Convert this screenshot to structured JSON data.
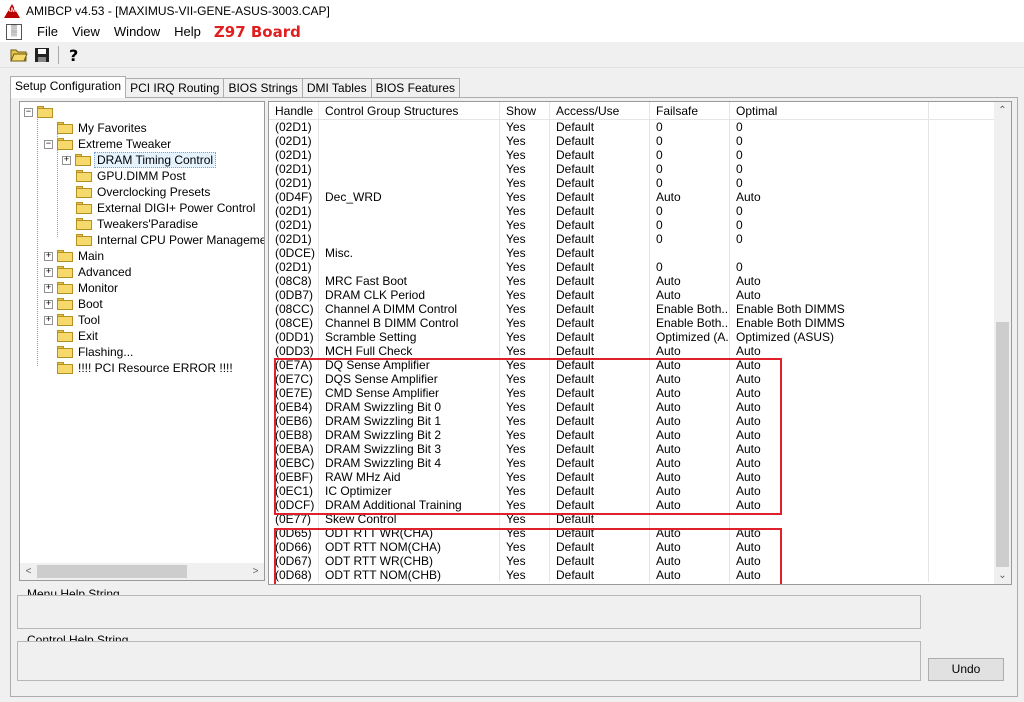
{
  "window": {
    "title": "AMIBCP v4.53 - [MAXIMUS-VII-GENE-ASUS-3003.CAP]",
    "app_icon_text": "AMI"
  },
  "menu": {
    "items": [
      "File",
      "View",
      "Window",
      "Help"
    ],
    "annotation": "Z97 Board",
    "annotation_color": "#e02020"
  },
  "toolbar": {
    "icons": [
      "open-folder-icon",
      "save-icon",
      "help-icon"
    ]
  },
  "tabs": [
    "Setup Configuration",
    "PCI IRQ Routing",
    "BIOS Strings",
    "DMI Tables",
    "BIOS Features"
  ],
  "active_tab": "Setup Configuration",
  "tree": {
    "root": "",
    "nodes": [
      "My Favorites",
      "Extreme Tweaker",
      "DRAM Timing Control",
      "GPU.DIMM Post",
      "Overclocking Presets",
      "External DIGI+ Power Control",
      "Tweakers'Paradise",
      "Internal CPU Power Management",
      "Main",
      "Advanced",
      "Monitor",
      "Boot",
      "Tool",
      "Exit",
      "Flashing...",
      "!!!! PCI Resource ERROR !!!!"
    ],
    "selected": "DRAM Timing Control"
  },
  "grid": {
    "columns": [
      "Handle",
      "Control Group Structures",
      "Show",
      "Access/Use",
      "Failsafe",
      "Optimal"
    ],
    "rows": [
      [
        "(02D1)",
        "",
        "Yes",
        "Default",
        "0",
        "0"
      ],
      [
        "(02D1)",
        "",
        "Yes",
        "Default",
        "0",
        "0"
      ],
      [
        "(02D1)",
        "",
        "Yes",
        "Default",
        "0",
        "0"
      ],
      [
        "(02D1)",
        "",
        "Yes",
        "Default",
        "0",
        "0"
      ],
      [
        "(02D1)",
        "",
        "Yes",
        "Default",
        "0",
        "0"
      ],
      [
        "(0D4F)",
        "Dec_WRD",
        "Yes",
        "Default",
        "Auto",
        "Auto"
      ],
      [
        "(02D1)",
        "",
        "Yes",
        "Default",
        "0",
        "0"
      ],
      [
        "(02D1)",
        "",
        "Yes",
        "Default",
        "0",
        "0"
      ],
      [
        "(02D1)",
        "",
        "Yes",
        "Default",
        "0",
        "0"
      ],
      [
        "(0DCE)",
        "Misc.",
        "Yes",
        "Default",
        "",
        ""
      ],
      [
        "(02D1)",
        "",
        "Yes",
        "Default",
        "0",
        "0"
      ],
      [
        "(08C8)",
        "MRC Fast Boot",
        "Yes",
        "Default",
        "Auto",
        "Auto"
      ],
      [
        "(0DB7)",
        "DRAM CLK Period",
        "Yes",
        "Default",
        "Auto",
        "Auto"
      ],
      [
        "(08CC)",
        "Channel A DIMM Control",
        "Yes",
        "Default",
        "Enable Both...",
        "Enable Both DIMMS"
      ],
      [
        "(08CE)",
        "Channel B DIMM Control",
        "Yes",
        "Default",
        "Enable Both...",
        "Enable Both DIMMS"
      ],
      [
        "(0DD1)",
        "Scramble Setting",
        "Yes",
        "Default",
        "Optimized (A...",
        "Optimized (ASUS)"
      ],
      [
        "(0DD3)",
        "MCH Full Check",
        "Yes",
        "Default",
        "Auto",
        "Auto"
      ],
      [
        "(0E7A)",
        "DQ Sense Amplifier",
        "Yes",
        "Default",
        "Auto",
        "Auto"
      ],
      [
        "(0E7C)",
        "DQS Sense Amplifier",
        "Yes",
        "Default",
        "Auto",
        "Auto"
      ],
      [
        "(0E7E)",
        "CMD Sense Amplifier",
        "Yes",
        "Default",
        "Auto",
        "Auto"
      ],
      [
        "(0EB4)",
        "DRAM Swizzling Bit 0",
        "Yes",
        "Default",
        "Auto",
        "Auto"
      ],
      [
        "(0EB6)",
        "DRAM Swizzling Bit 1",
        "Yes",
        "Default",
        "Auto",
        "Auto"
      ],
      [
        "(0EB8)",
        "DRAM Swizzling Bit 2",
        "Yes",
        "Default",
        "Auto",
        "Auto"
      ],
      [
        "(0EBA)",
        "DRAM Swizzling Bit 3",
        "Yes",
        "Default",
        "Auto",
        "Auto"
      ],
      [
        "(0EBC)",
        "DRAM Swizzling Bit 4",
        "Yes",
        "Default",
        "Auto",
        "Auto"
      ],
      [
        "(0EBF)",
        "RAW MHz Aid",
        "Yes",
        "Default",
        "Auto",
        "Auto"
      ],
      [
        "(0EC1)",
        "IC Optimizer",
        "Yes",
        "Default",
        "Auto",
        "Auto"
      ],
      [
        "(0DCF)",
        "DRAM Additional Training",
        "Yes",
        "Default",
        "Auto",
        "Auto"
      ],
      [
        "(0E77)",
        "Skew Control",
        "Yes",
        "Default",
        "",
        ""
      ],
      [
        "(0D65)",
        "ODT RTT WR(CHA)",
        "Yes",
        "Default",
        "Auto",
        "Auto"
      ],
      [
        "(0D66)",
        "ODT RTT NOM(CHA)",
        "Yes",
        "Default",
        "Auto",
        "Auto"
      ],
      [
        "(0D67)",
        "ODT RTT WR(CHB)",
        "Yes",
        "Default",
        "Auto",
        "Auto"
      ],
      [
        "(0D68)",
        "ODT RTT NOM(CHB)",
        "Yes",
        "Default",
        "Auto",
        "Auto"
      ]
    ]
  },
  "menu_help": {
    "label": "Menu Help String"
  },
  "control_help": {
    "label": "Control Help String"
  },
  "undo": {
    "label": "Undo"
  },
  "highlight_color": "#e0202a"
}
